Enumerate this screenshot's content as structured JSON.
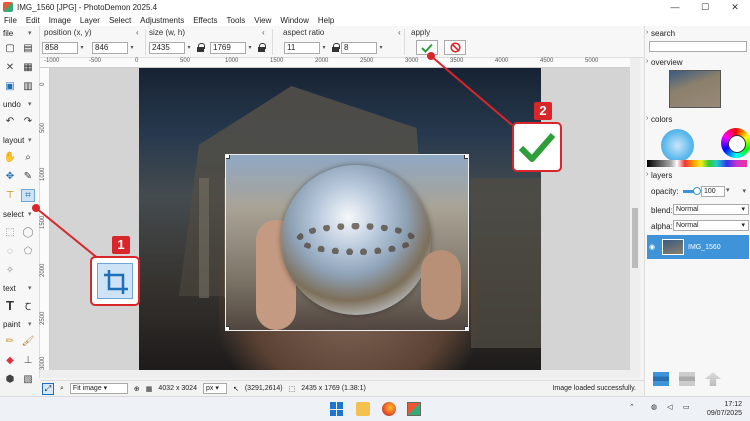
{
  "window": {
    "title": "IMG_1560 [JPG] - PhotoDemon 2025.4",
    "controls": [
      "—",
      "☐",
      "✕"
    ]
  },
  "menu": [
    "File",
    "Edit",
    "Image",
    "Layer",
    "Select",
    "Adjustments",
    "Effects",
    "Tools",
    "View",
    "Window",
    "Help"
  ],
  "toolbar": {
    "position_label": "position (x, y)",
    "pos_x": "858",
    "pos_y": "846",
    "size_label": "size (w, h)",
    "size_w": "2435",
    "size_h": "1769",
    "ratio_label": "aspect ratio",
    "ratio_w": "11",
    "ratio_h": "8",
    "apply_label": "apply"
  },
  "left_tools": {
    "file": "file",
    "undo": "undo",
    "layout": "layout",
    "select": "select",
    "text": "text",
    "paint": "paint"
  },
  "ruler_top": [
    "-1000",
    "-500",
    "0",
    "500",
    "1000",
    "1500",
    "2000",
    "2500",
    "3000",
    "3500",
    "4000",
    "4500",
    "5000"
  ],
  "ruler_left": [
    "0",
    "500",
    "1000",
    "1500",
    "2000",
    "2500",
    "3000"
  ],
  "status": {
    "zoom": "Fit image",
    "dimensions": "4032 x 3024",
    "unit": "px",
    "cursor": "(3291,2614)",
    "selection": "2435 x 1769  (1.38:1)",
    "message": "Image loaded successfully."
  },
  "right_panel": {
    "search_label": "search",
    "overview_label": "overview",
    "colors_label": "colors",
    "layers_label": "layers",
    "opacity_label": "opacity:",
    "opacity_value": "100",
    "opacity_fraction": 1.0,
    "blend_label": "blend:",
    "blend_value": "Normal",
    "alpha_label": "alpha:",
    "alpha_value": "Normal",
    "layer_name": "IMG_1560"
  },
  "taskbar": {
    "time": "17:12",
    "date": "09/07/2025"
  },
  "annotations": {
    "step1": "1",
    "step2": "2"
  },
  "colors": {
    "accent": "#3f93d8",
    "callout": "#d9262b",
    "apply_green": "#2e9e3a",
    "cancel_red": "#d9262b"
  }
}
